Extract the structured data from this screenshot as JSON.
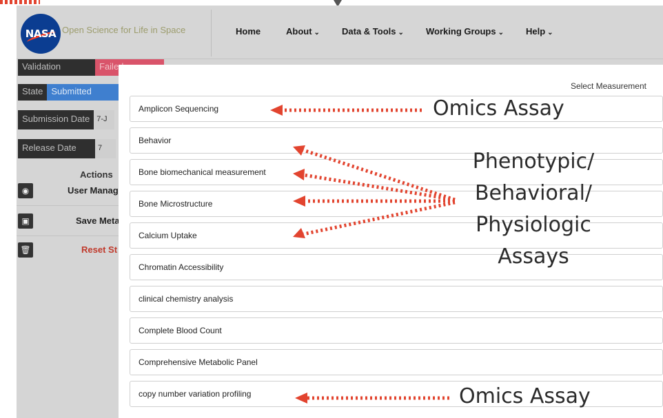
{
  "header": {
    "site_name": "Open Science for Life in Space",
    "logo_text": "NASA",
    "nav": [
      {
        "label": "Home",
        "dropdown": false
      },
      {
        "label": "About",
        "dropdown": true
      },
      {
        "label": "Data & Tools",
        "dropdown": true
      },
      {
        "label": "Working Groups",
        "dropdown": true
      },
      {
        "label": "Help",
        "dropdown": true
      }
    ]
  },
  "sidebar": {
    "validation_label": "Validation",
    "validation_value": "Failed",
    "state_label": "State",
    "state_value": "Submitted",
    "submission_date_label": "Submission Date",
    "submission_date_value": "7-J",
    "release_date_label": "Release Date",
    "release_date_value": "7",
    "actions_title": "Actions",
    "actions": [
      {
        "label": "User Manag",
        "icon": "user-circle-icon",
        "danger": false
      },
      {
        "label": "Save Meta",
        "icon": "save-icon",
        "danger": false
      },
      {
        "label": "Reset St",
        "icon": "trash-icon",
        "danger": true
      }
    ]
  },
  "modal": {
    "title": "Select Measurement",
    "items": [
      "Amplicon Sequencing",
      "Behavior",
      "Bone biomechanical measurement",
      "Bone Microstructure",
      "Calcium Uptake",
      "Chromatin Accessibility",
      "clinical chemistry analysis",
      "Complete Blood Count",
      "Comprehensive Metabolic Panel",
      "copy number variation profiling"
    ]
  },
  "annotations": {
    "omics_top": "Omics Assay",
    "phenotypic_lines": [
      "Phenotypic/",
      "Behavioral/",
      "Physiologic",
      "Assays"
    ],
    "omics_bottom": "Omics Assay",
    "arrow_color": "#e2442f"
  }
}
